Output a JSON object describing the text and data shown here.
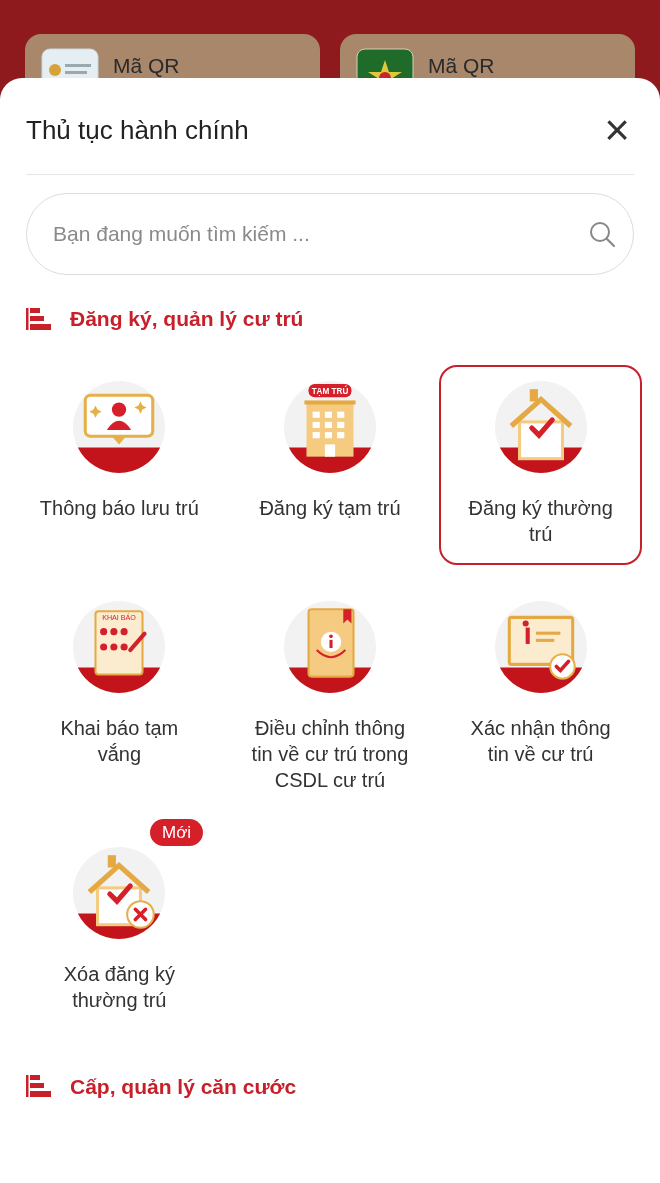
{
  "background_cards": [
    {
      "label": "Mã QR",
      "kind": "document"
    },
    {
      "label": "Mã QR",
      "kind": "emblem"
    }
  ],
  "sheet": {
    "title": "Thủ tục hành chính",
    "close": "×"
  },
  "search": {
    "placeholder": "Bạn đang muốn tìm kiếm ..."
  },
  "sections": [
    {
      "title": "Đăng ký, quản lý cư trú",
      "items": [
        {
          "label": "Thông báo lưu trú",
          "kind": "speech-bubble",
          "selected": false
        },
        {
          "label": "Đăng ký tạm trú",
          "kind": "building",
          "selected": false,
          "sign": "TẠM TRÚ"
        },
        {
          "label": "Đăng ký thường trú",
          "kind": "house-check",
          "selected": true
        },
        {
          "label": "Khai báo tạm vắng",
          "kind": "form",
          "selected": false,
          "sign": "KHAI BÁO"
        },
        {
          "label": "Điều chỉnh thông tin về cư trú trong CSDL cư trú",
          "kind": "book",
          "selected": false
        },
        {
          "label": "Xác nhận thông tin về cư trú",
          "kind": "info-card",
          "selected": false
        },
        {
          "label": "Xóa đăng ký thường trú",
          "kind": "house-remove",
          "selected": false,
          "badge": "Mới"
        }
      ]
    },
    {
      "title": "Cấp, quản lý căn cước"
    }
  ]
}
